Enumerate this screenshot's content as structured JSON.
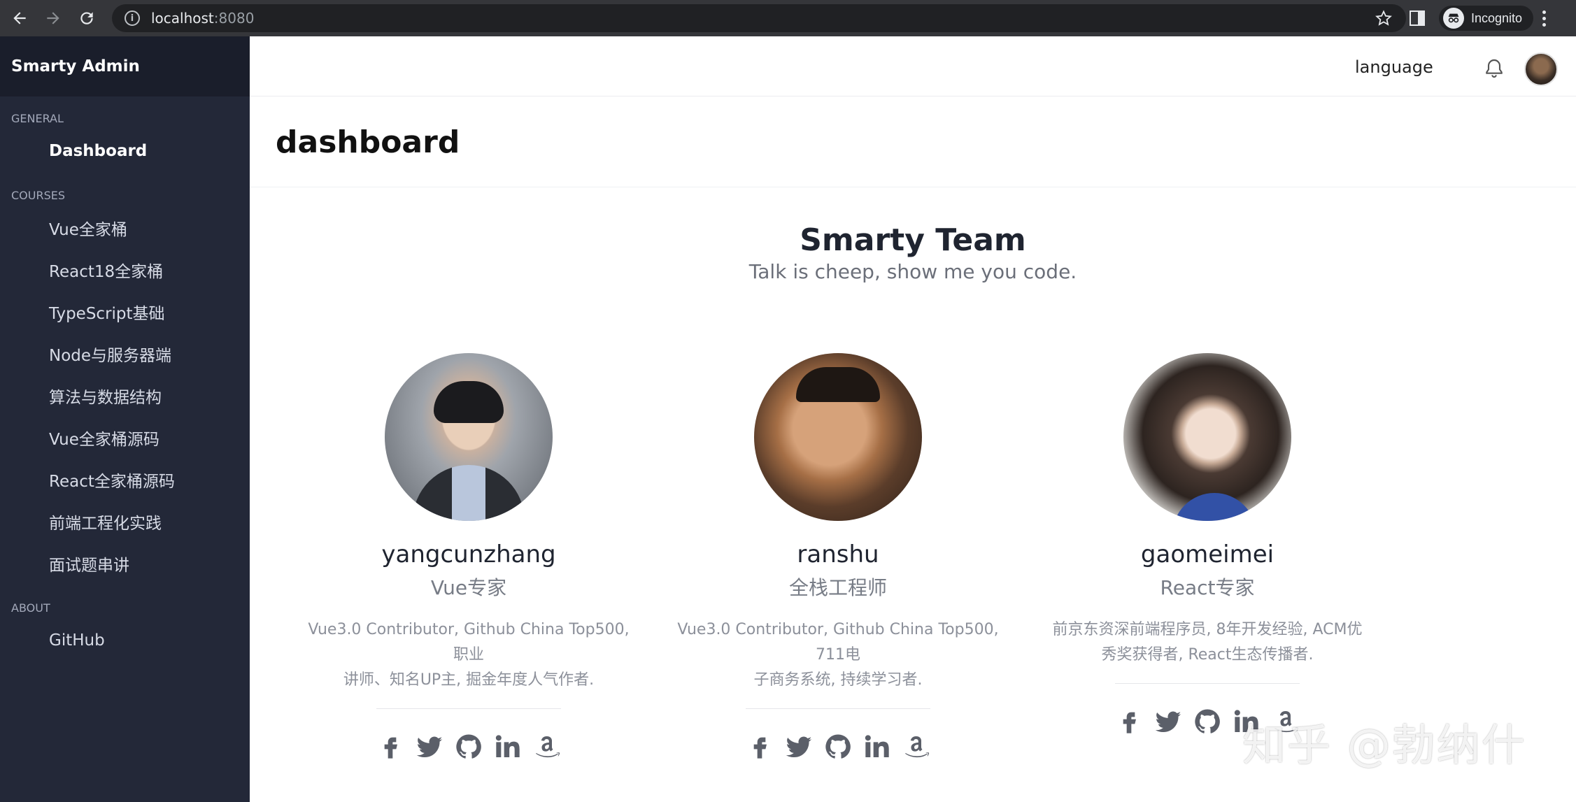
{
  "browser": {
    "url_host": "localhost",
    "url_port": ":8080",
    "incognito_label": "Incognito"
  },
  "sidebar": {
    "brand": "Smarty Admin",
    "sections": {
      "general": "GENERAL",
      "courses": "COURSES",
      "about": "ABOUT"
    },
    "general_items": [
      {
        "label": "Dashboard"
      }
    ],
    "course_items": [
      {
        "label": "Vue全家桶"
      },
      {
        "label": "React18全家桶"
      },
      {
        "label": "TypeScript基础"
      },
      {
        "label": "Node与服务器端"
      },
      {
        "label": "算法与数据结构"
      },
      {
        "label": "Vue全家桶源码"
      },
      {
        "label": "React全家桶源码"
      },
      {
        "label": "前端工程化实践"
      },
      {
        "label": "面试题串讲"
      }
    ],
    "about_items": [
      {
        "label": "GitHub"
      }
    ]
  },
  "topbar": {
    "language_label": "language",
    "bell_icon": "bell-icon",
    "avatar_icon": "user-avatar"
  },
  "page": {
    "title": "dashboard"
  },
  "team": {
    "title": "Smarty Team",
    "subtitle": "Talk is cheep, show me you code.",
    "members": [
      {
        "name": "yangcunzhang",
        "role": "Vue专家",
        "desc_line1": "Vue3.0 Contributor, Github China Top500, 职业",
        "desc_line2": "讲师、知名UP主, 掘金年度人气作者."
      },
      {
        "name": "ranshu",
        "role": "全栈工程师",
        "desc_line1": "Vue3.0 Contributor, Github China Top500, 711电",
        "desc_line2": "子商务系统, 持续学习者."
      },
      {
        "name": "gaomeimei",
        "role": "React专家",
        "desc_line1": "前京东资深前端程序员, 8年开发经验, ACM优",
        "desc_line2": "秀奖获得者, React生态传播者."
      }
    ],
    "social_icons": [
      "facebook-icon",
      "twitter-icon",
      "github-icon",
      "linkedin-icon",
      "amazon-icon"
    ]
  },
  "watermark": "知乎 @勃纳什",
  "colors": {
    "sidebar_bg": "#232838",
    "brand_bg": "#1a1e2b",
    "chrome_bg": "#35363a"
  }
}
